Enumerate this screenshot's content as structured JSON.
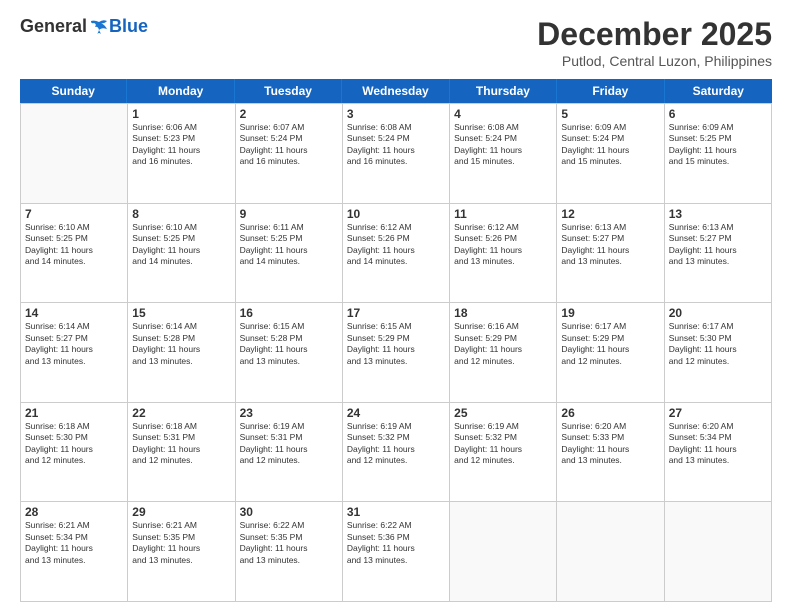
{
  "logo": {
    "general": "General",
    "blue": "Blue"
  },
  "title": "December 2025",
  "location": "Putlod, Central Luzon, Philippines",
  "days_header": [
    "Sunday",
    "Monday",
    "Tuesday",
    "Wednesday",
    "Thursday",
    "Friday",
    "Saturday"
  ],
  "weeks": [
    [
      {
        "num": "",
        "info": ""
      },
      {
        "num": "1",
        "info": "Sunrise: 6:06 AM\nSunset: 5:23 PM\nDaylight: 11 hours\nand 16 minutes."
      },
      {
        "num": "2",
        "info": "Sunrise: 6:07 AM\nSunset: 5:24 PM\nDaylight: 11 hours\nand 16 minutes."
      },
      {
        "num": "3",
        "info": "Sunrise: 6:08 AM\nSunset: 5:24 PM\nDaylight: 11 hours\nand 16 minutes."
      },
      {
        "num": "4",
        "info": "Sunrise: 6:08 AM\nSunset: 5:24 PM\nDaylight: 11 hours\nand 15 minutes."
      },
      {
        "num": "5",
        "info": "Sunrise: 6:09 AM\nSunset: 5:24 PM\nDaylight: 11 hours\nand 15 minutes."
      },
      {
        "num": "6",
        "info": "Sunrise: 6:09 AM\nSunset: 5:25 PM\nDaylight: 11 hours\nand 15 minutes."
      }
    ],
    [
      {
        "num": "7",
        "info": "Sunrise: 6:10 AM\nSunset: 5:25 PM\nDaylight: 11 hours\nand 14 minutes."
      },
      {
        "num": "8",
        "info": "Sunrise: 6:10 AM\nSunset: 5:25 PM\nDaylight: 11 hours\nand 14 minutes."
      },
      {
        "num": "9",
        "info": "Sunrise: 6:11 AM\nSunset: 5:25 PM\nDaylight: 11 hours\nand 14 minutes."
      },
      {
        "num": "10",
        "info": "Sunrise: 6:12 AM\nSunset: 5:26 PM\nDaylight: 11 hours\nand 14 minutes."
      },
      {
        "num": "11",
        "info": "Sunrise: 6:12 AM\nSunset: 5:26 PM\nDaylight: 11 hours\nand 13 minutes."
      },
      {
        "num": "12",
        "info": "Sunrise: 6:13 AM\nSunset: 5:27 PM\nDaylight: 11 hours\nand 13 minutes."
      },
      {
        "num": "13",
        "info": "Sunrise: 6:13 AM\nSunset: 5:27 PM\nDaylight: 11 hours\nand 13 minutes."
      }
    ],
    [
      {
        "num": "14",
        "info": "Sunrise: 6:14 AM\nSunset: 5:27 PM\nDaylight: 11 hours\nand 13 minutes."
      },
      {
        "num": "15",
        "info": "Sunrise: 6:14 AM\nSunset: 5:28 PM\nDaylight: 11 hours\nand 13 minutes."
      },
      {
        "num": "16",
        "info": "Sunrise: 6:15 AM\nSunset: 5:28 PM\nDaylight: 11 hours\nand 13 minutes."
      },
      {
        "num": "17",
        "info": "Sunrise: 6:15 AM\nSunset: 5:29 PM\nDaylight: 11 hours\nand 13 minutes."
      },
      {
        "num": "18",
        "info": "Sunrise: 6:16 AM\nSunset: 5:29 PM\nDaylight: 11 hours\nand 12 minutes."
      },
      {
        "num": "19",
        "info": "Sunrise: 6:17 AM\nSunset: 5:29 PM\nDaylight: 11 hours\nand 12 minutes."
      },
      {
        "num": "20",
        "info": "Sunrise: 6:17 AM\nSunset: 5:30 PM\nDaylight: 11 hours\nand 12 minutes."
      }
    ],
    [
      {
        "num": "21",
        "info": "Sunrise: 6:18 AM\nSunset: 5:30 PM\nDaylight: 11 hours\nand 12 minutes."
      },
      {
        "num": "22",
        "info": "Sunrise: 6:18 AM\nSunset: 5:31 PM\nDaylight: 11 hours\nand 12 minutes."
      },
      {
        "num": "23",
        "info": "Sunrise: 6:19 AM\nSunset: 5:31 PM\nDaylight: 11 hours\nand 12 minutes."
      },
      {
        "num": "24",
        "info": "Sunrise: 6:19 AM\nSunset: 5:32 PM\nDaylight: 11 hours\nand 12 minutes."
      },
      {
        "num": "25",
        "info": "Sunrise: 6:19 AM\nSunset: 5:32 PM\nDaylight: 11 hours\nand 12 minutes."
      },
      {
        "num": "26",
        "info": "Sunrise: 6:20 AM\nSunset: 5:33 PM\nDaylight: 11 hours\nand 13 minutes."
      },
      {
        "num": "27",
        "info": "Sunrise: 6:20 AM\nSunset: 5:34 PM\nDaylight: 11 hours\nand 13 minutes."
      }
    ],
    [
      {
        "num": "28",
        "info": "Sunrise: 6:21 AM\nSunset: 5:34 PM\nDaylight: 11 hours\nand 13 minutes."
      },
      {
        "num": "29",
        "info": "Sunrise: 6:21 AM\nSunset: 5:35 PM\nDaylight: 11 hours\nand 13 minutes."
      },
      {
        "num": "30",
        "info": "Sunrise: 6:22 AM\nSunset: 5:35 PM\nDaylight: 11 hours\nand 13 minutes."
      },
      {
        "num": "31",
        "info": "Sunrise: 6:22 AM\nSunset: 5:36 PM\nDaylight: 11 hours\nand 13 minutes."
      },
      {
        "num": "",
        "info": ""
      },
      {
        "num": "",
        "info": ""
      },
      {
        "num": "",
        "info": ""
      }
    ]
  ]
}
